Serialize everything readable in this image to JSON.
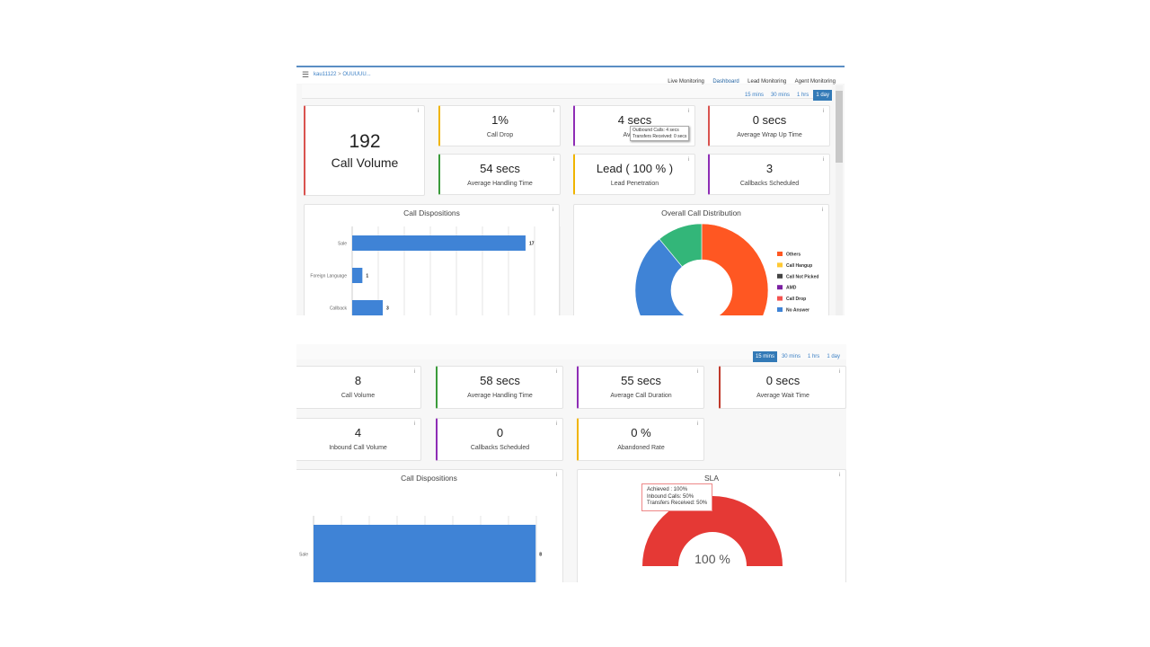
{
  "top": {
    "breadcrumb": [
      "kau11122",
      "OUUUUU..."
    ],
    "breadcrumb_sep": ">",
    "nav": [
      {
        "label": "Live Monitoring",
        "active": false
      },
      {
        "label": "Dashboard",
        "active": true
      },
      {
        "label": "Lead Monitoring",
        "active": false
      },
      {
        "label": "Agent Monitoring",
        "active": false
      }
    ],
    "time_filters": [
      {
        "label": "15 mins",
        "active": false
      },
      {
        "label": "30 mins",
        "active": false
      },
      {
        "label": "1 hrs",
        "active": false
      },
      {
        "label": "1 day",
        "active": true
      }
    ],
    "big_card": {
      "value": "192",
      "label": "Call Volume",
      "color": "#d9534f"
    },
    "cards": [
      {
        "value": "1%",
        "label": "Call Drop",
        "color": "#f0b400"
      },
      {
        "value": "4 secs",
        "label": "Average",
        "color": "#8e2db5"
      },
      {
        "value": "0 secs",
        "label": "Average Wrap Up Time",
        "color": "#d9534f"
      },
      {
        "value": "54 secs",
        "label": "Average Handling Time",
        "color": "#3a9b3a"
      },
      {
        "value": "Lead  ( 100 % )",
        "label": "Lead Penetration",
        "color": "#f0b400"
      },
      {
        "value": "3",
        "label": "Callbacks Scheduled",
        "color": "#8e2db5"
      }
    ],
    "tooltip": [
      "Outbound Calls: 4 secs",
      "Transfers Received: 0 secs"
    ],
    "info_icon": "i"
  },
  "bottom": {
    "time_filters": [
      {
        "label": "15 mins",
        "active": true
      },
      {
        "label": "30 mins",
        "active": false
      },
      {
        "label": "1 hrs",
        "active": false
      },
      {
        "label": "1 day",
        "active": false
      }
    ],
    "cards": [
      {
        "value": "8",
        "label": "Call Volume",
        "color": ""
      },
      {
        "value": "58 secs",
        "label": "Average Handling Time",
        "color": "#3a9b3a"
      },
      {
        "value": "55 secs",
        "label": "Average Call Duration",
        "color": "#8e2db5"
      },
      {
        "value": "0 secs",
        "label": "Average Wait Time",
        "color": "#c0392b"
      },
      {
        "value": "4",
        "label": "Inbound Call Volume",
        "color": ""
      },
      {
        "value": "0",
        "label": "Callbacks Scheduled",
        "color": "#8e2db5"
      },
      {
        "value": "0 %",
        "label": "Abandoned Rate",
        "color": "#f0b400"
      }
    ],
    "sla_tooltip": [
      "Achieved : 100%",
      "Inbound Calls: 50%",
      "Transfers Received: 50%"
    ]
  },
  "chart_data": [
    {
      "type": "bar",
      "orientation": "horizontal",
      "title": "Call Dispositions",
      "categories": [
        "Sale",
        "Foreign Language",
        "Callback"
      ],
      "values": [
        17,
        1,
        3
      ],
      "color": "#3f83d6"
    },
    {
      "type": "pie",
      "donut": true,
      "title": "Overall Call Distribution",
      "slices": [
        {
          "name": "Others",
          "value": 50,
          "color": "#ff5722"
        },
        {
          "name": "",
          "value": 39,
          "color": "#3f83d6"
        },
        {
          "name": "",
          "value": 11,
          "color": "#33b679"
        }
      ],
      "legend": [
        {
          "name": "Others",
          "color": "#ff5722"
        },
        {
          "name": "Call Hangup",
          "color": "#ffc933"
        },
        {
          "name": "Call Not Picked",
          "color": "#444444"
        },
        {
          "name": "AMD",
          "color": "#7b1fa2"
        },
        {
          "name": "Call Drop",
          "color": "#f4534f"
        },
        {
          "name": "No Answer",
          "color": "#3f83d6"
        }
      ],
      "legend_position": "right"
    },
    {
      "type": "bar",
      "orientation": "horizontal",
      "title": "Call Dispositions",
      "categories": [
        "Sale"
      ],
      "values": [
        8
      ],
      "color": "#3f83d6"
    },
    {
      "type": "gauge",
      "title": "SLA",
      "value": 100,
      "max": 100,
      "label": "100 %",
      "color": "#e53935"
    }
  ]
}
